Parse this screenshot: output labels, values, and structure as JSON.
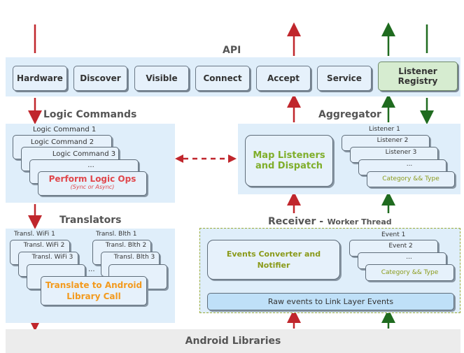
{
  "api": {
    "title": "API",
    "buttons": [
      "Hardware",
      "Discover",
      "Visible",
      "Connect",
      "Accept",
      "Service",
      "Listener Registry"
    ]
  },
  "logic": {
    "title": "Logic Commands",
    "items": [
      "Logic Command 1",
      "Logic Command 2",
      "Logic Command 3",
      "..."
    ],
    "main": "Perform Logic Ops",
    "sub": "(Sync or Async)"
  },
  "aggregator": {
    "title": "Aggregator",
    "main": "Map Listeners and Dispatch",
    "items": [
      "Listener 1",
      "Listener 2",
      "Listener 3",
      "...",
      "Category && Type"
    ]
  },
  "translators": {
    "title": "Translators",
    "wifi": [
      "Transl. WiFi 1",
      "Transl. WiFi 2",
      "Transl. WiFi 3"
    ],
    "blth": [
      "Transl. Blth 1",
      "Transl. Blth 2",
      "Transl. Blth 3"
    ],
    "ellipsis": "...",
    "main": "Translate to Android Library Call"
  },
  "receiver": {
    "title": "Receiver -",
    "subtitle": "Worker Thread",
    "main": "Events Converter and Notifier",
    "items": [
      "Event 1",
      "Event 2",
      "...",
      "Category && Type"
    ],
    "raw": "Raw events to Link Layer Events"
  },
  "footer": {
    "title": "Android Libraries"
  },
  "colors": {
    "red": "#c0262c",
    "green": "#1f6b1f",
    "panel": "#dfeefa",
    "olive": "#8a9a1a",
    "orange": "#f39a1e"
  }
}
